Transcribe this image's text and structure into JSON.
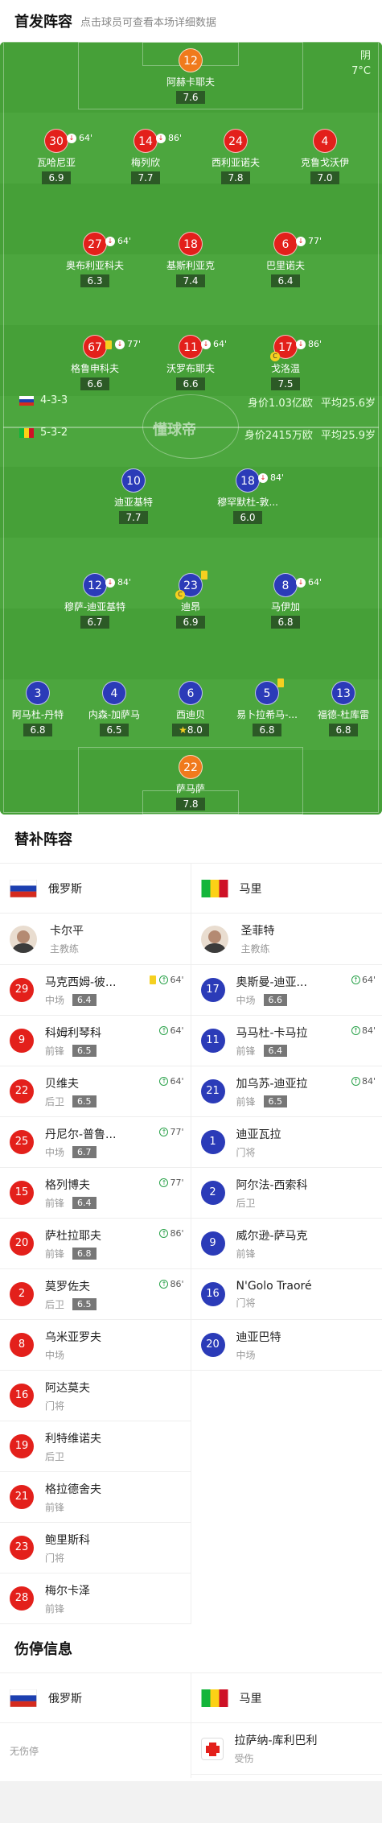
{
  "header": {
    "title": "首发阵容",
    "subtitle": "点击球员可查看本场详细数据"
  },
  "weather": {
    "condition": "阴",
    "temp": "7°C"
  },
  "watermark": "懂球帝",
  "russia_lineup": {
    "formation": "4-3-3",
    "value": "身价1.03亿欧",
    "age": "平均25.6岁"
  },
  "mali_lineup": {
    "formation": "5-3-2",
    "value": "身价2415万欧",
    "age": "平均25.9岁"
  },
  "players": {
    "p1": {
      "num": "12",
      "name": "阿赫卡耶夫",
      "rating": "7.6"
    },
    "p2": {
      "num": "30",
      "name": "瓦哈尼亚",
      "rating": "6.9",
      "sub": "64'"
    },
    "p3": {
      "num": "14",
      "name": "梅列欣",
      "rating": "7.7",
      "sub": "86'"
    },
    "p4": {
      "num": "24",
      "name": "西利亚诺夫",
      "rating": "7.8"
    },
    "p5": {
      "num": "4",
      "name": "克鲁戈沃伊",
      "rating": "7.0"
    },
    "p6": {
      "num": "27",
      "name": "奥布利亚科夫",
      "rating": "6.3",
      "sub": "64'"
    },
    "p7": {
      "num": "18",
      "name": "基斯利亚克",
      "rating": "7.4"
    },
    "p8": {
      "num": "6",
      "name": "巴里诺夫",
      "rating": "6.4",
      "sub": "77'"
    },
    "p9": {
      "num": "67",
      "name": "格鲁申科夫",
      "rating": "6.6",
      "sub": "77'"
    },
    "p10": {
      "num": "11",
      "name": "沃罗布耶夫",
      "rating": "6.6",
      "sub": "64'"
    },
    "p11": {
      "num": "17",
      "name": "戈洛温",
      "rating": "7.5",
      "sub": "86'",
      "captain": "C"
    },
    "m1": {
      "num": "10",
      "name": "迪亚基特",
      "rating": "7.7"
    },
    "m2": {
      "num": "18",
      "name": "穆罕默杜-敦...",
      "rating": "6.0",
      "sub": "84'"
    },
    "m3": {
      "num": "12",
      "name": "穆萨-迪亚基特",
      "rating": "6.7",
      "sub": "84'"
    },
    "m4": {
      "num": "23",
      "name": "迪昂",
      "rating": "6.9",
      "captain": "C"
    },
    "m5": {
      "num": "8",
      "name": "马伊加",
      "rating": "6.8",
      "sub": "64'"
    },
    "m6": {
      "num": "3",
      "name": "阿马杜-丹特",
      "rating": "6.8"
    },
    "m7": {
      "num": "4",
      "name": "内森-加萨马",
      "rating": "6.5"
    },
    "m8": {
      "num": "6",
      "name": "西迪贝",
      "rating": "8.0"
    },
    "m9": {
      "num": "5",
      "name": "易卜拉希马-...",
      "rating": "6.8"
    },
    "m10": {
      "num": "13",
      "name": "福德-杜库雷",
      "rating": "6.8"
    },
    "m11": {
      "num": "22",
      "name": "萨马萨",
      "rating": "7.8"
    }
  },
  "subs_title": "替补阵容",
  "russia": {
    "name": "俄罗斯",
    "coach": {
      "name": "卡尔平",
      "role": "主教练"
    },
    "subs": [
      {
        "num": "29",
        "name": "马克西姆-彼...",
        "pos": "中场",
        "rating": "6.4",
        "time": "64'",
        "card": true
      },
      {
        "num": "9",
        "name": "科姆利琴科",
        "pos": "前锋",
        "rating": "6.5",
        "time": "64'"
      },
      {
        "num": "22",
        "name": "贝维夫",
        "pos": "后卫",
        "rating": "6.5",
        "time": "64'"
      },
      {
        "num": "25",
        "name": "丹尼尔-普鲁...",
        "pos": "中场",
        "rating": "6.7",
        "time": "77'"
      },
      {
        "num": "15",
        "name": "格列博夫",
        "pos": "前锋",
        "rating": "6.4",
        "time": "77'"
      },
      {
        "num": "20",
        "name": "萨杜拉耶夫",
        "pos": "前锋",
        "rating": "6.8",
        "time": "86'"
      },
      {
        "num": "2",
        "name": "莫罗佐夫",
        "pos": "后卫",
        "rating": "6.5",
        "time": "86'"
      },
      {
        "num": "8",
        "name": "乌米亚罗夫",
        "pos": "中场"
      },
      {
        "num": "16",
        "name": "阿达莫夫",
        "pos": "门将"
      },
      {
        "num": "19",
        "name": "利特维诺夫",
        "pos": "后卫"
      },
      {
        "num": "21",
        "name": "格拉德舍夫",
        "pos": "前锋"
      },
      {
        "num": "23",
        "name": "鲍里斯科",
        "pos": "门将"
      },
      {
        "num": "28",
        "name": "梅尔卡泽",
        "pos": "前锋"
      }
    ]
  },
  "mali": {
    "name": "马里",
    "coach": {
      "name": "圣菲特",
      "role": "主教练"
    },
    "subs": [
      {
        "num": "17",
        "name": "奥斯曼-迪亚...",
        "pos": "中场",
        "rating": "6.6",
        "time": "64'"
      },
      {
        "num": "11",
        "name": "马马杜-卡马拉",
        "pos": "前锋",
        "rating": "6.4",
        "time": "84'"
      },
      {
        "num": "21",
        "name": "加乌苏-迪亚拉",
        "pos": "前锋",
        "rating": "6.5",
        "time": "84'"
      },
      {
        "num": "1",
        "name": "迪亚瓦拉",
        "pos": "门将"
      },
      {
        "num": "2",
        "name": "阿尔法-西索科",
        "pos": "后卫"
      },
      {
        "num": "9",
        "name": "威尔逊-萨马克",
        "pos": "前锋"
      },
      {
        "num": "16",
        "name": "N'Golo Traoré",
        "pos": "门将"
      },
      {
        "num": "20",
        "name": "迪亚巴特",
        "pos": "中场"
      }
    ]
  },
  "injury_title": "伤停信息",
  "injury": {
    "russia_team": "俄罗斯",
    "mali_team": "马里",
    "russia_none": "无伤停",
    "mali_player": {
      "name": "拉萨纳-库利巴利",
      "status": "受伤"
    }
  }
}
